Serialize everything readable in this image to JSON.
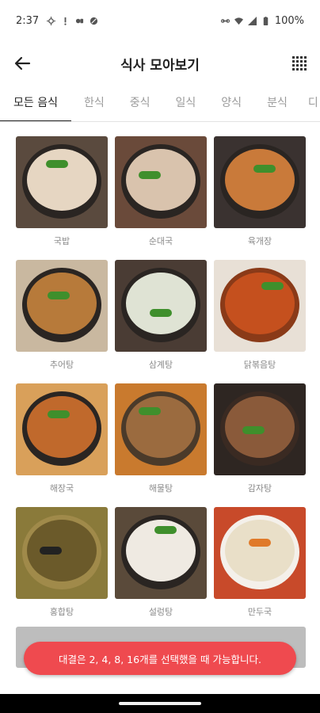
{
  "status_bar": {
    "time": "2:37",
    "battery": "100%"
  },
  "app_bar": {
    "title": "식사 모아보기"
  },
  "tabs": [
    {
      "label": "모든 음식"
    },
    {
      "label": "한식"
    },
    {
      "label": "중식"
    },
    {
      "label": "일식"
    },
    {
      "label": "양식"
    },
    {
      "label": "분식"
    },
    {
      "label": "디"
    }
  ],
  "foods": [
    {
      "name": "국밥",
      "color": "#e6d6c2"
    },
    {
      "name": "순대국",
      "color": "#d9c3ad"
    },
    {
      "name": "육개장",
      "color": "#c97a3a"
    },
    {
      "name": "추어탕",
      "color": "#b77a3a"
    },
    {
      "name": "삼계탕",
      "color": "#dfe3d4"
    },
    {
      "name": "닭볶음탕",
      "color": "#c5501e"
    },
    {
      "name": "해장국",
      "color": "#c0692c"
    },
    {
      "name": "해물탕",
      "color": "#9b6b3f"
    },
    {
      "name": "감자탕",
      "color": "#8a5a3a"
    },
    {
      "name": "홍합탕",
      "color": "#6b5a2a"
    },
    {
      "name": "설렁탕",
      "color": "#efeae2"
    },
    {
      "name": "만두국",
      "color": "#e9dfc8"
    }
  ],
  "toast": {
    "message": "대결은 2, 4, 8, 16개를 선택했을 때 가능합니다."
  }
}
